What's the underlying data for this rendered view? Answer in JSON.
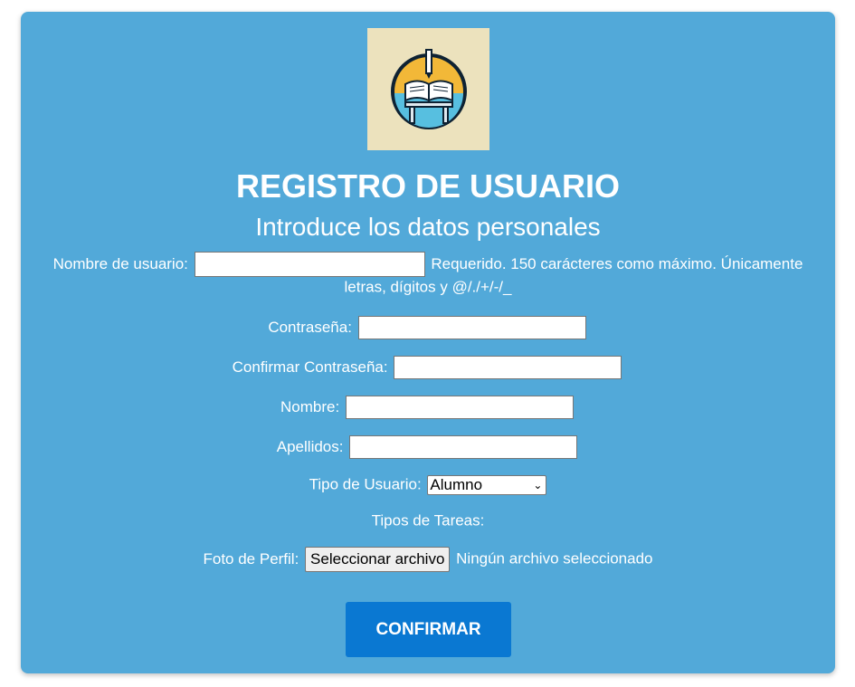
{
  "header": {
    "title": "REGISTRO DE USUARIO",
    "subtitle": "Introduce los datos personales"
  },
  "form": {
    "username_label": "Nombre de usuario:",
    "username_value": "",
    "username_help": "Requerido. 150 carácteres como máximo. Únicamente letras, dígitos y @/./+/-/_",
    "password_label": "Contraseña:",
    "password_value": "",
    "confirm_password_label": "Confirmar Contraseña:",
    "confirm_password_value": "",
    "first_name_label": "Nombre:",
    "first_name_value": "",
    "last_name_label": "Apellidos:",
    "last_name_value": "",
    "user_type_label": "Tipo de Usuario:",
    "user_type_selected": "Alumno",
    "task_types_label": "Tipos de Tareas:",
    "photo_label": "Foto de Perfil:",
    "photo_button": "Seleccionar archivo",
    "photo_status": "Ningún archivo seleccionado",
    "submit_label": "CONFIRMAR"
  },
  "icons": {
    "logo": "book-desk-pencil-logo",
    "select_arrow": "chevron-down-icon"
  },
  "colors": {
    "card_background": "#52a9d9",
    "submit_background": "#0a78d2",
    "text": "#ffffff",
    "logo_background": "#ece2bd"
  }
}
